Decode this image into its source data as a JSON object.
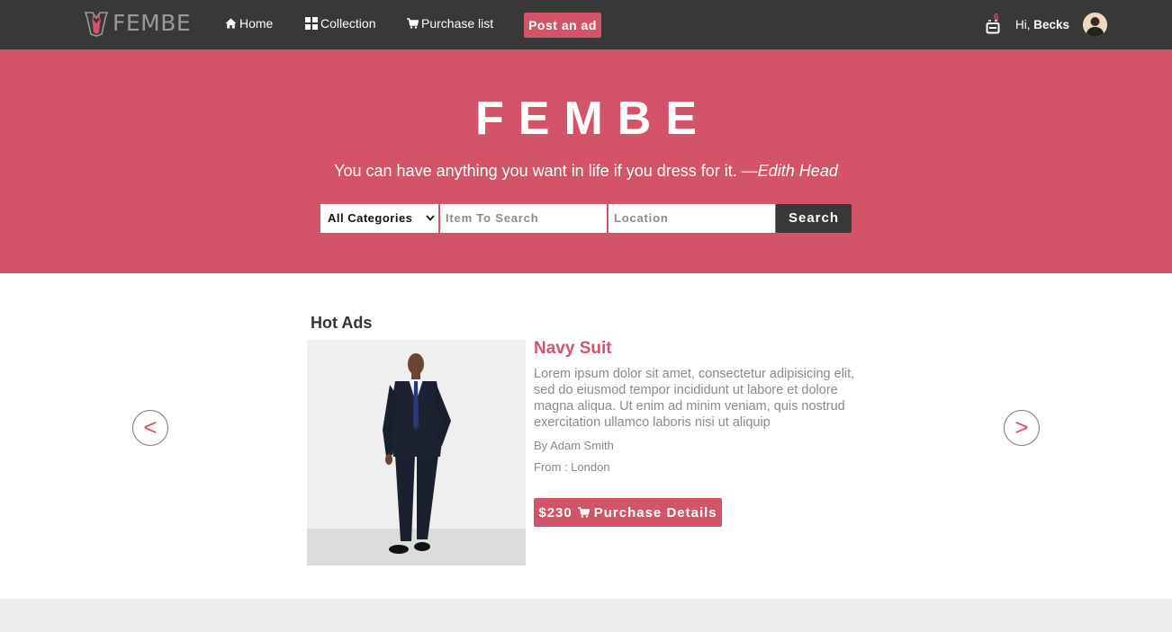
{
  "brand": {
    "name": "FEMBE"
  },
  "nav": {
    "links": [
      {
        "label": "Home",
        "icon": "home-icon"
      },
      {
        "label": "Collection",
        "icon": "grid-icon"
      },
      {
        "label": "Purchase list",
        "icon": "cart-icon"
      }
    ],
    "post_ad_label": "Post an ad",
    "cart_count": "6",
    "greeting_prefix": "Hi,",
    "user_name": "Becks"
  },
  "hero": {
    "title": "FEMBE",
    "quote": "You can have anything you want in life if you dress for it.",
    "quote_author": "—Edith Head",
    "category_selected": "All Categories",
    "item_placeholder": "Item To Search",
    "location_placeholder": "Location",
    "search_label": "Search"
  },
  "hot_ads": {
    "title": "Hot Ads",
    "prev_label": "<",
    "next_label": ">",
    "product": {
      "name": "Navy Suit",
      "description": "Lorem ipsum dolor sit amet, consectetur adipisicing elit, sed do eiusmod tempor incididunt ut labore et dolore magna aliqua. Ut enim ad minim veniam, quis nostrud exercitation ullamco laboris nisi ut aliquip",
      "author": "By Adam Smith",
      "location": "From : London",
      "price": "$230",
      "button_label": "Purchase Details"
    }
  },
  "colors": {
    "accent": "#d35468",
    "dark": "#383838"
  }
}
